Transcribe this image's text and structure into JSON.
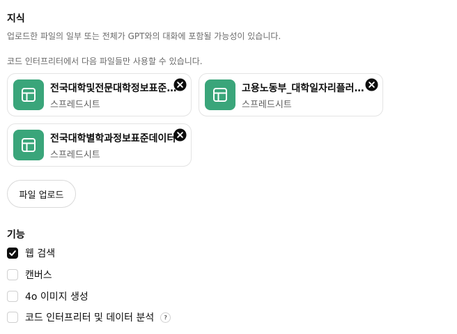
{
  "knowledge": {
    "title": "지식",
    "description": "업로드한 파일의 일부 또는 전체가 GPT와의 대화에 포함될 가능성이 있습니다.",
    "code_note": "코드 인터프리터에서 다음 파일들만 사용할 수 있습니다.",
    "files": [
      {
        "name": "전국대학및전문대학정보표준데이터",
        "type": "스프레드시트",
        "icon": "spreadsheet-icon"
      },
      {
        "name": "고용노동부_대학일자리플러스센터",
        "type": "스프레드시트",
        "icon": "spreadsheet-icon"
      },
      {
        "name": "전국대학별학과정보표준데이터",
        "type": "스프레드시트",
        "icon": "spreadsheet-icon"
      }
    ],
    "upload_label": "파일 업로드"
  },
  "capabilities": {
    "title": "기능",
    "items": [
      {
        "label": "웹 검색",
        "checked": true
      },
      {
        "label": "캔버스",
        "checked": false
      },
      {
        "label": "4o 이미지 생성",
        "checked": false
      },
      {
        "label": "코드 인터프리터 및 데이터 분석",
        "checked": false,
        "help": "?"
      }
    ]
  },
  "colors": {
    "spreadsheet_green": "#3aa57a",
    "checkbox_checked": "#0d0d0d"
  }
}
